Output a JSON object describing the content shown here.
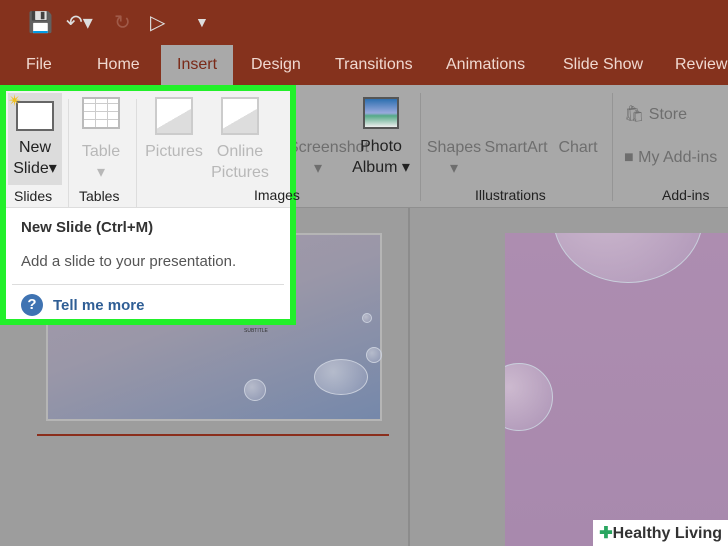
{
  "quick_access": {
    "icons": [
      "save-icon",
      "undo-icon",
      "redo-icon",
      "present-icon",
      "customize-icon"
    ]
  },
  "tabs": [
    "File",
    "Home",
    "Insert",
    "Design",
    "Transitions",
    "Animations",
    "Slide Show",
    "Review"
  ],
  "ribbon": {
    "new_slide": [
      "New",
      "Slide"
    ],
    "table": "Table",
    "pictures": "Pictures",
    "online_pictures": [
      "Online",
      "Pictures"
    ],
    "screenshot": "Screenshot",
    "photo_album": [
      "Photo",
      "Album"
    ],
    "shapes": "Shapes",
    "smartart": "SmartArt",
    "chart": "Chart",
    "store": "Store",
    "my_addins": "My Add-ins",
    "groups": {
      "slides": "Slides",
      "tables": "Tables",
      "images": "Images",
      "illustrations": "Illustrations",
      "addins": "Add-ins"
    }
  },
  "tooltip": {
    "title": "New Slide (Ctrl+M)",
    "description": "Add a slide to your presentation.",
    "link": "Tell me more"
  },
  "thumbnail": {
    "subtitle": "SUBTITLE"
  },
  "watermark": "Healthy Living",
  "colors": {
    "titlebar": "#85321d",
    "highlight": "#22f02a"
  }
}
